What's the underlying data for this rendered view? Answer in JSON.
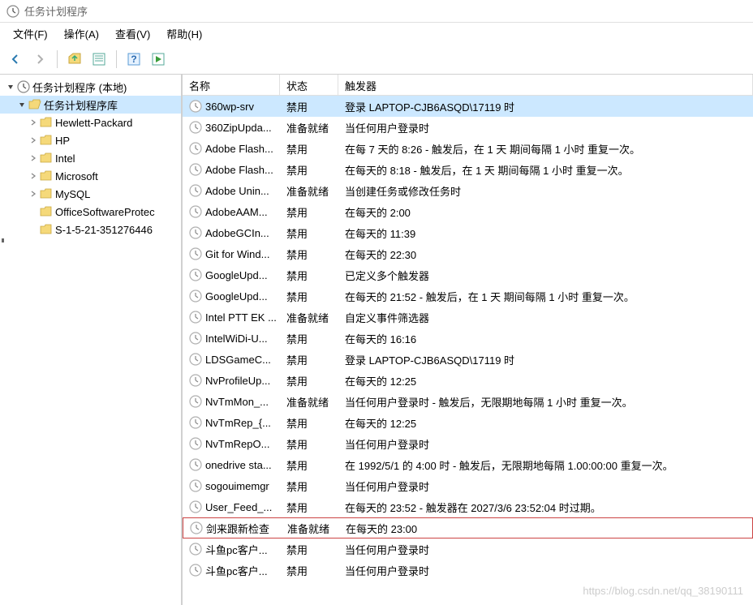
{
  "window": {
    "title": "任务计划程序"
  },
  "menus": [
    {
      "label": "文件(F)"
    },
    {
      "label": "操作(A)"
    },
    {
      "label": "查看(V)"
    },
    {
      "label": "帮助(H)"
    }
  ],
  "tree": {
    "root": {
      "label": "任务计划程序 (本地)",
      "expanded": true,
      "children": [
        {
          "label": "任务计划程序库",
          "expanded": true,
          "selected": true,
          "children": [
            {
              "label": "Hewlett-Packard"
            },
            {
              "label": "HP"
            },
            {
              "label": "Intel"
            },
            {
              "label": "Microsoft"
            },
            {
              "label": "MySQL"
            },
            {
              "label": "OfficeSoftwareProtec"
            },
            {
              "label": "S-1-5-21-351276446"
            }
          ]
        }
      ]
    }
  },
  "columns": {
    "name": "名称",
    "status": "状态",
    "trigger": "触发器"
  },
  "tasks": [
    {
      "name": "360wp-srv",
      "status": "禁用",
      "trigger": "登录 LAPTOP-CJB6ASQD\\17119 时",
      "selected": true
    },
    {
      "name": "360ZipUpda...",
      "status": "准备就绪",
      "trigger": "当任何用户登录时"
    },
    {
      "name": "Adobe Flash...",
      "status": "禁用",
      "trigger": "在每 7 天的 8:26 - 触发后，在 1 天 期间每隔 1 小时 重复一次。"
    },
    {
      "name": "Adobe Flash...",
      "status": "禁用",
      "trigger": "在每天的 8:18 - 触发后，在 1 天 期间每隔 1 小时 重复一次。"
    },
    {
      "name": "Adobe Unin...",
      "status": "准备就绪",
      "trigger": "当创建任务或修改任务时"
    },
    {
      "name": "AdobeAAM...",
      "status": "禁用",
      "trigger": "在每天的 2:00"
    },
    {
      "name": "AdobeGCIn...",
      "status": "禁用",
      "trigger": "在每天的 11:39"
    },
    {
      "name": "Git for Wind...",
      "status": "禁用",
      "trigger": "在每天的 22:30"
    },
    {
      "name": "GoogleUpd...",
      "status": "禁用",
      "trigger": "已定义多个触发器"
    },
    {
      "name": "GoogleUpd...",
      "status": "禁用",
      "trigger": "在每天的 21:52 - 触发后，在 1 天 期间每隔 1 小时 重复一次。"
    },
    {
      "name": "Intel PTT EK ...",
      "status": "准备就绪",
      "trigger": "自定义事件筛选器"
    },
    {
      "name": "IntelWiDi-U...",
      "status": "禁用",
      "trigger": "在每天的 16:16"
    },
    {
      "name": "LDSGameC...",
      "status": "禁用",
      "trigger": "登录 LAPTOP-CJB6ASQD\\17119 时"
    },
    {
      "name": "NvProfileUp...",
      "status": "禁用",
      "trigger": "在每天的 12:25"
    },
    {
      "name": "NvTmMon_...",
      "status": "准备就绪",
      "trigger": "当任何用户登录时 - 触发后，无限期地每隔 1 小时 重复一次。"
    },
    {
      "name": "NvTmRep_{...",
      "status": "禁用",
      "trigger": "在每天的 12:25"
    },
    {
      "name": "NvTmRepO...",
      "status": "禁用",
      "trigger": "当任何用户登录时"
    },
    {
      "name": "onedrive sta...",
      "status": "禁用",
      "trigger": "在 1992/5/1 的 4:00 时 - 触发后，无限期地每隔 1.00:00:00 重复一次。"
    },
    {
      "name": "sogouimemgr",
      "status": "禁用",
      "trigger": "当任何用户登录时"
    },
    {
      "name": "User_Feed_...",
      "status": "禁用",
      "trigger": "在每天的 23:52 - 触发器在 2027/3/6 23:52:04 时过期。"
    },
    {
      "name": "剑来跟新检查",
      "status": "准备就绪",
      "trigger": "在每天的 23:00",
      "highlighted": true
    },
    {
      "name": "斗鱼pc客户...",
      "status": "禁用",
      "trigger": "当任何用户登录时"
    },
    {
      "name": "斗鱼pc客户...",
      "status": "禁用",
      "trigger": "当任何用户登录时"
    }
  ],
  "watermark": "https://blog.csdn.net/qq_38190111"
}
